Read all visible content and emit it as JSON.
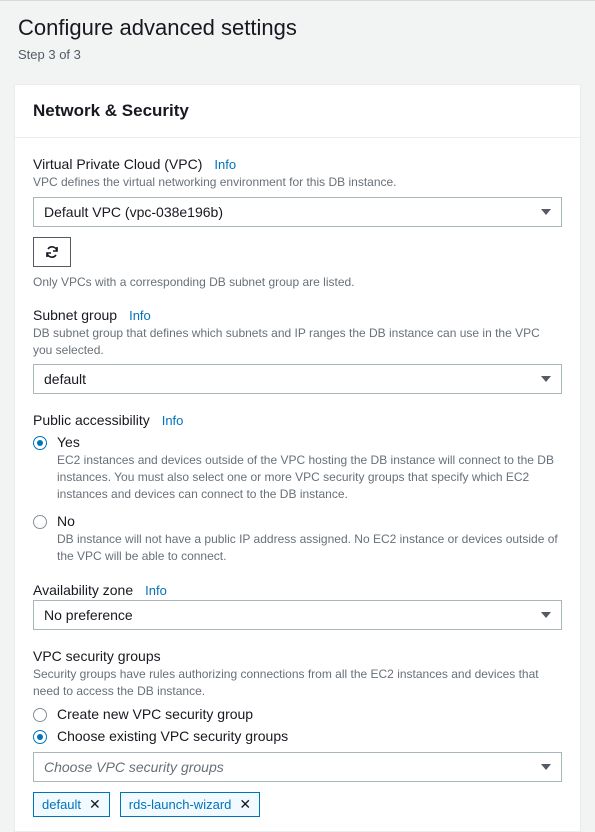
{
  "header": {
    "title": "Configure advanced settings",
    "step": "Step 3 of 3"
  },
  "panel": {
    "title": "Network & Security"
  },
  "vpc": {
    "label": "Virtual Private Cloud (VPC)",
    "info": "Info",
    "desc": "VPC defines the virtual networking environment for this DB instance.",
    "value": "Default VPC (vpc-038e196b)",
    "helper": "Only VPCs with a corresponding DB subnet group are listed."
  },
  "subnet": {
    "label": "Subnet group",
    "info": "Info",
    "desc": "DB subnet group that defines which subnets and IP ranges the DB instance can use in the VPC you selected.",
    "value": "default"
  },
  "public": {
    "label": "Public accessibility",
    "info": "Info",
    "options": [
      {
        "label": "Yes",
        "desc": "EC2 instances and devices outside of the VPC hosting the DB instance will connect to the DB instances. You must also select one or more VPC security groups that specify which EC2 instances and devices can connect to the DB instance.",
        "selected": true
      },
      {
        "label": "No",
        "desc": "DB instance will not have a public IP address assigned. No EC2 instance or devices outside of the VPC will be able to connect.",
        "selected": false
      }
    ]
  },
  "az": {
    "label": "Availability zone",
    "info": "Info",
    "value": "No preference"
  },
  "sg": {
    "label": "VPC security groups",
    "desc": "Security groups have rules authorizing connections from all the EC2 instances and devices that need to access the DB instance.",
    "options": [
      {
        "label": "Create new VPC security group",
        "selected": false
      },
      {
        "label": "Choose existing VPC security groups",
        "selected": true
      }
    ],
    "select_placeholder": "Choose VPC security groups",
    "tags": [
      "default",
      "rds-launch-wizard"
    ]
  }
}
